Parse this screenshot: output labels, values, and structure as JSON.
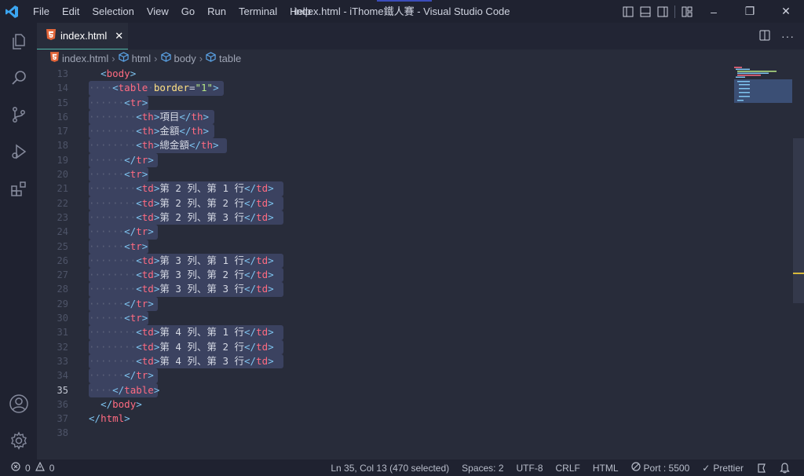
{
  "title_bar": {
    "menu": [
      "File",
      "Edit",
      "Selection",
      "View",
      "Go",
      "Run",
      "Terminal",
      "Help"
    ],
    "window_title": "index.html - iThome鐵人賽 - Visual Studio Code"
  },
  "tab": {
    "label": "index.html",
    "close": "✕"
  },
  "breadcrumb": [
    "index.html",
    "html",
    "body",
    "table"
  ],
  "editor": {
    "line_numbers": [
      "13",
      "14",
      "15",
      "16",
      "17",
      "18",
      "19",
      "20",
      "21",
      "22",
      "23",
      "24",
      "25",
      "26",
      "27",
      "28",
      "29",
      "30",
      "31",
      "32",
      "33",
      "34",
      "35",
      "36",
      "37",
      "38"
    ],
    "active_line": "35",
    "text": {
      "item": "項目",
      "amount": "金額",
      "total": "總金額",
      "r2c1": "第 2 列、第 1 行",
      "r2c2": "第 2 列、第 2 行",
      "r2c3": "第 2 列、第 3 行",
      "r3c1": "第 3 列、第 1 行",
      "r3c2": "第 3 列、第 2 行",
      "r3c3": "第 3 列、第 3 行",
      "r4c1": "第 4 列、第 1 行",
      "r4c2": "第 4 列、第 2 行",
      "r4c3": "第 4 列、第 3 行"
    }
  },
  "status_bar": {
    "errors": "0",
    "warnings": "0",
    "cursor": "Ln 35, Col 13 (470 selected)",
    "spaces": "Spaces: 2",
    "encoding": "UTF-8",
    "eol": "CRLF",
    "language": "HTML",
    "port": "Port : 5500",
    "prettier": "Prettier"
  },
  "colors": {
    "background": "#282c3a",
    "sidebar": "#1f2230",
    "selection": "#3b4260",
    "tag": "#ff6b81",
    "bracket": "#7fc4f0",
    "attribute": "#ffe083",
    "string": "#b8e986",
    "accent": "#51b8a8"
  }
}
